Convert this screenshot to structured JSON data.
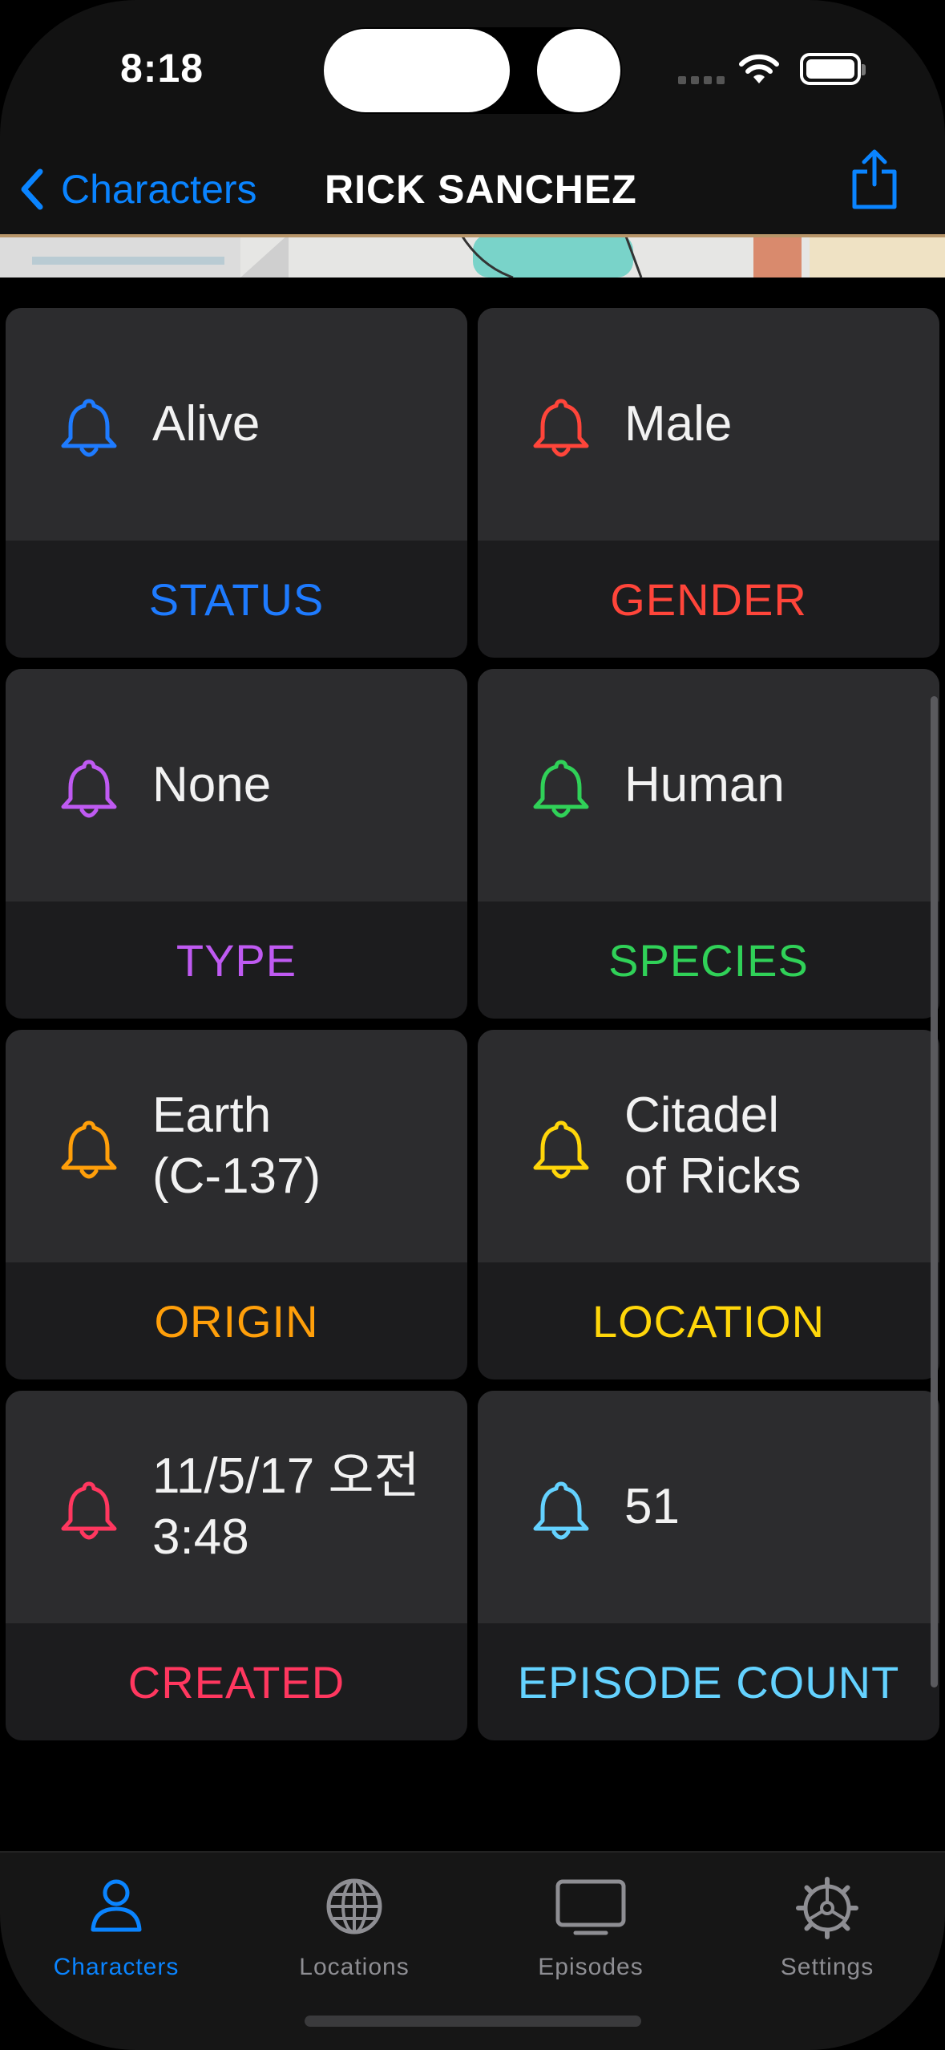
{
  "status_bar": {
    "time": "8:18"
  },
  "nav": {
    "back_label": "Characters",
    "title": "RICK SANCHEZ"
  },
  "colors": {
    "accent": "#0a84ff",
    "status": "#1e7bff",
    "gender": "#ff453a",
    "type": "#bf5af2",
    "species": "#30d158",
    "origin": "#ff9f0a",
    "location": "#ffd60a",
    "created": "#ff375f",
    "episode_count": "#64d2ff",
    "tab_inactive": "#8e8e93"
  },
  "cards": [
    {
      "value": "Alive",
      "label": "STATUS",
      "icon": "bell-icon"
    },
    {
      "value": "Male",
      "label": "GENDER",
      "icon": "bell-icon"
    },
    {
      "value": "None",
      "label": "TYPE",
      "icon": "bell-icon"
    },
    {
      "value": "Human",
      "label": "SPECIES",
      "icon": "bell-icon"
    },
    {
      "value": "Earth\n(C-137)",
      "label": "ORIGIN",
      "icon": "bell-icon"
    },
    {
      "value": "Citadel\nof Ricks",
      "label": "LOCATION",
      "icon": "bell-icon"
    },
    {
      "value": "11/5/17 오전\n3:48",
      "label": "CREATED",
      "icon": "bell-icon"
    },
    {
      "value": "51",
      "label": "EPISODE COUNT",
      "icon": "bell-icon"
    }
  ],
  "tabs": [
    {
      "label": "Characters",
      "icon": "person-icon",
      "active": true
    },
    {
      "label": "Locations",
      "icon": "globe-icon",
      "active": false
    },
    {
      "label": "Episodes",
      "icon": "tv-icon",
      "active": false
    },
    {
      "label": "Settings",
      "icon": "gear-icon",
      "active": false
    }
  ]
}
